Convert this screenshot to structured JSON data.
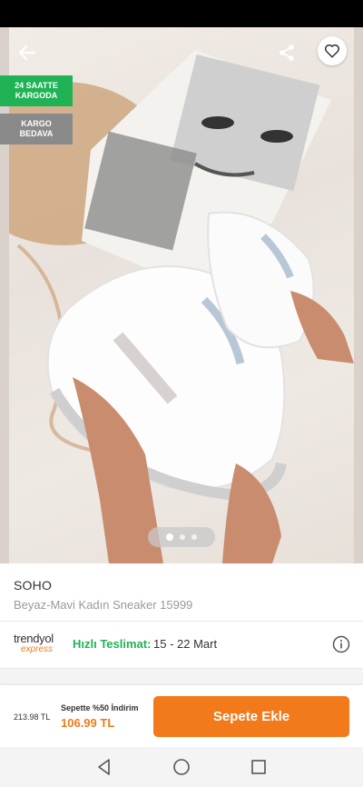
{
  "badges": {
    "fast_cargo": "24 SAATTE\nKARGODA",
    "free_cargo": "KARGO\nBEDAVA"
  },
  "product": {
    "brand": "SOHO",
    "subtitle": "Beyaz-Mavi  Kadın Sneaker 15999"
  },
  "gallery": {
    "image_count": 3,
    "active_index": 0
  },
  "delivery": {
    "logo_main": "trendyol",
    "logo_sub": "express",
    "fast_label": "Hızlı Teslimat:",
    "date_range": "15 - 22 Mart"
  },
  "purchase": {
    "old_price": "213.98 TL",
    "promo_text": "Sepette %50 İndirim",
    "new_price": "106.99 TL",
    "add_to_cart": "Sepete Ekle"
  },
  "colors": {
    "accent": "#f27a1a",
    "badge_green": "#1fb355",
    "badge_gray": "#8a8a8a"
  }
}
